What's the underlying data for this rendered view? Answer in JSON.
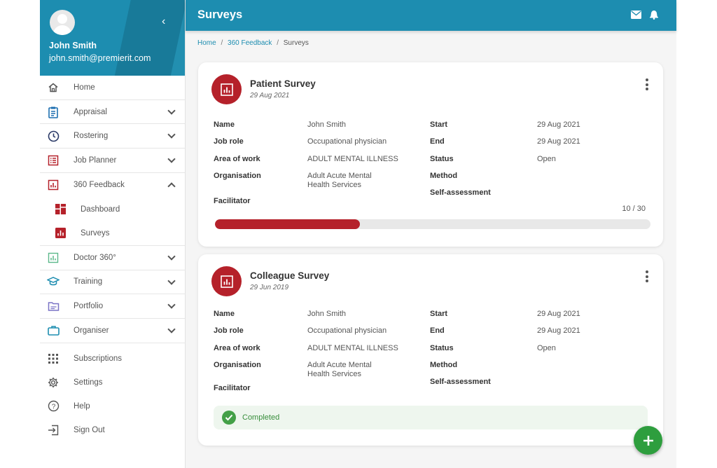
{
  "profile": {
    "name": "John Smith",
    "email": "john.smith@premierit.com"
  },
  "sidebar": {
    "items": [
      {
        "label": "Home",
        "icon": "home-icon"
      },
      {
        "label": "Appraisal",
        "icon": "clipboard-icon"
      },
      {
        "label": "Rostering",
        "icon": "clock-icon"
      },
      {
        "label": "Job Planner",
        "icon": "list-icon"
      },
      {
        "label": "360 Feedback",
        "icon": "chart-icon"
      },
      {
        "label": "Dashboard",
        "icon": "dashboard-icon"
      },
      {
        "label": "Surveys",
        "icon": "survey-icon"
      },
      {
        "label": "Doctor 360°",
        "icon": "chart-outline-icon"
      },
      {
        "label": "Training",
        "icon": "graduation-cap-icon"
      },
      {
        "label": "Portfolio",
        "icon": "folder-icon"
      },
      {
        "label": "Organiser",
        "icon": "briefcase-icon"
      },
      {
        "label": "Subscriptions",
        "icon": "grid-icon"
      },
      {
        "label": "Settings",
        "icon": "gear-icon"
      },
      {
        "label": "Help",
        "icon": "help-icon"
      },
      {
        "label": "Sign Out",
        "icon": "sign-out-icon"
      }
    ]
  },
  "header": {
    "title": "Surveys"
  },
  "breadcrumb": {
    "home": "Home",
    "section": "360 Feedback",
    "current": "Surveys",
    "divider": "/"
  },
  "labels": {
    "name": "Name",
    "job_role": "Job role",
    "area": "Area of work",
    "org": "Organisation",
    "facilitator": "Facilitator",
    "start": "Start",
    "end": "End",
    "status": "Status",
    "method": "Method",
    "self": "Self-assessment"
  },
  "surveys": [
    {
      "title": "Patient Survey",
      "date": "29 Aug 2021",
      "name": "John Smith",
      "job_role": "Occupational physician",
      "area": "ADULT MENTAL ILLNESS",
      "org_line1": "Adult Acute Mental",
      "org_line2": "Health Services",
      "start": "29 Aug 2021",
      "end": "29 Aug 2021",
      "status": "Open",
      "progress_text": "10 / 30",
      "progress": 0.333
    },
    {
      "title": "Colleague Survey",
      "date": "29 Jun 2019",
      "name": "John Smith",
      "job_role": "Occupational physician",
      "area": "ADULT MENTAL ILLNESS",
      "org_line1": "Adult Acute Mental",
      "org_line2": "Health Services",
      "start": "29 Aug 2021",
      "end": "29 Aug 2021",
      "status": "Open",
      "completed_text": "Completed"
    }
  ],
  "colors": {
    "primary": "#1d8db0",
    "accent": "#b5212a",
    "success": "#2e9e3e"
  }
}
